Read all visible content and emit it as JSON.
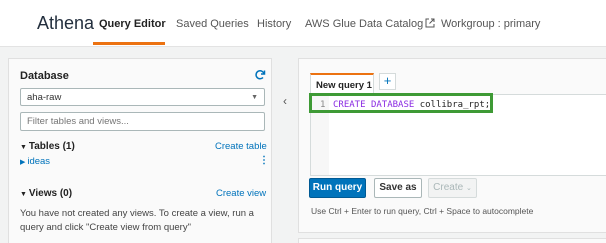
{
  "nav": {
    "logo": "Athena",
    "tabs": [
      {
        "label": "Query Editor"
      },
      {
        "label": "Saved Queries"
      },
      {
        "label": "History"
      },
      {
        "label": "AWS Glue Data Catalog"
      },
      {
        "label": "Workgroup : primary"
      }
    ],
    "accent_color": "#ec7211"
  },
  "sidebar": {
    "title": "Database",
    "database_select": "aha-raw",
    "filter_placeholder": "Filter tables and views...",
    "tables": {
      "header": "Tables (1)",
      "create_link": "Create table",
      "items": [
        "ideas"
      ]
    },
    "views": {
      "header": "Views (0)",
      "create_link": "Create view",
      "empty_message": "You have not created any views. To create a view, run a query and click \"Create view from query\""
    }
  },
  "editor": {
    "tab_label": "New query 1",
    "add_tab": "+",
    "line_number": "1",
    "code": {
      "kw1": "CREATE",
      "kw2": "DATABASE",
      "identifier": "collibra_rpt;"
    },
    "buttons": {
      "run": "Run query",
      "save": "Save as",
      "create": "Create"
    },
    "hint": "Use Ctrl + Enter to run query, Ctrl + Space to autocomplete",
    "collapse_icon": "chevron-left-icon"
  }
}
